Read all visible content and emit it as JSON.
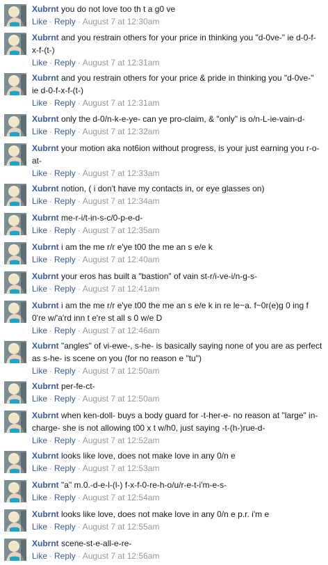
{
  "actions": {
    "like": "Like",
    "reply": "Reply",
    "dot": "·"
  },
  "comments": [
    {
      "author": "Xubrnt",
      "text": "you do not love too th t a g0 ve",
      "time": "August 7 at 12:30am"
    },
    {
      "author": "Xubrnt",
      "text": "and you restrain others for your price in thinking you \"d-0ve-\" ie d-0-f-x-f-(t-)",
      "time": "August 7 at 12:31am"
    },
    {
      "author": "Xubrnt",
      "text": "and you restrain others for your price & pride in thinking you \"d-0ve-\" ie d-0-f-x-f-(t-)",
      "time": "August 7 at 12:31am"
    },
    {
      "author": "Xubrnt",
      "text": "only the d-0/n-k-e-ye- can ye pro-claim, & \"only\" is o/n-L-ie-vain-d-",
      "time": "August 7 at 12:32am"
    },
    {
      "author": "Xubrnt",
      "text": "your motion aka not6ion without progress, is your just earning you r-o-at-",
      "time": "August 7 at 12:33am"
    },
    {
      "author": "Xubrnt",
      "text": "notion, ( i don't have my contacts in, or eye glasses on)",
      "time": "August 7 at 12:34am"
    },
    {
      "author": "Xubrnt",
      "text": "me-r-i/t-in-s-c/0-p-e-d-",
      "time": "August 7 at 12:35am"
    },
    {
      "author": "Xubrnt",
      "text": "i am the me r/r e'ye t00 the me an s e/e k",
      "time": "August 7 at 12:40am"
    },
    {
      "author": "Xubrnt",
      "text": "your eros has built a \"bastion\" of vain st-r/i-ve-i/n-g-s-",
      "time": "August 7 at 12:41am"
    },
    {
      "author": "Xubrnt",
      "text": "i am the me r/r e'ye t00 the me an s e/e k in re le~a. f~0r(e)g 0 ing f 0're w/'a'rd inn t e're st all s 0 w/e D",
      "time": "August 7 at 12:46am"
    },
    {
      "author": "Xubrnt",
      "text": "\"angles\" of vi-ewe-, s-he- is basically saying none of you are as perfect as s-he- is scene on you (for no reason e \"tu\")",
      "time": "August 7 at 12:50am"
    },
    {
      "author": "Xubrnt",
      "text": "per-fe-ct-",
      "time": "August 7 at 12:50am"
    },
    {
      "author": "Xubrnt",
      "text": "when ken-doll- buys a body guard for -t-her-e- no reason at \"large\" in-charge- she is not allowing t00 x t w/h0, just saying -t-(h-)rue-d-",
      "time": "August 7 at 12:52am"
    },
    {
      "author": "Xubrnt",
      "text": "looks like love, does not make love in any 0/n e",
      "time": "August 7 at 12:53am"
    },
    {
      "author": "Xubrnt",
      "text": "\"a\" m.0.-d-e-l-(l-) f-x-f-0-re-h-o/u/r-e-t-i'm-e-s-",
      "time": "August 7 at 12:54am"
    },
    {
      "author": "Xubrnt",
      "text": "looks like love, does not make love in any 0/n e p.r. i'm e",
      "time": "August 7 at 12:55am"
    },
    {
      "author": "Xubrnt",
      "text": "scene-st-e-all-e-re-",
      "time": "August 7 at 12:56am"
    }
  ]
}
